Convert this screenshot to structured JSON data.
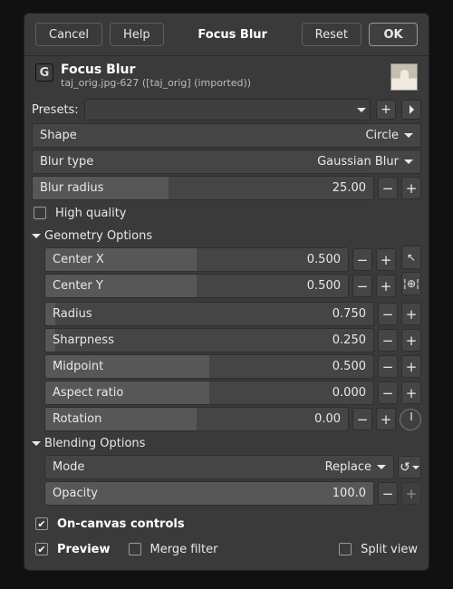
{
  "titlebar": {
    "cancel": "Cancel",
    "help": "Help",
    "name": "Focus Blur",
    "reset": "Reset",
    "ok": "OK"
  },
  "header": {
    "title": "Focus Blur",
    "subtitle": "taj_orig.jpg-627 ([taj_orig] (imported))"
  },
  "presets_label": "Presets:",
  "shape": {
    "label": "Shape",
    "value": "Circle"
  },
  "blur_type": {
    "label": "Blur type",
    "value": "Gaussian Blur"
  },
  "blur_radius": {
    "label": "Blur radius",
    "value": "25.00",
    "fill_pct": 40
  },
  "high_quality": {
    "label": "High quality",
    "checked": false
  },
  "geometry_section": "Geometry Options",
  "geom": {
    "center_x": {
      "label": "Center X",
      "value": "0.500",
      "fill_pct": 50
    },
    "center_y": {
      "label": "Center Y",
      "value": "0.500",
      "fill_pct": 50
    },
    "radius": {
      "label": "Radius",
      "value": "0.750",
      "fill_pct": 3
    },
    "sharpness": {
      "label": "Sharpness",
      "value": "0.250",
      "fill_pct": 3
    },
    "midpoint": {
      "label": "Midpoint",
      "value": "0.500",
      "fill_pct": 50
    },
    "aspect": {
      "label": "Aspect ratio",
      "value": "0.000",
      "fill_pct": 50
    },
    "rotation": {
      "label": "Rotation",
      "value": "0.00",
      "fill_pct": 50
    }
  },
  "blending_section": "Blending Options",
  "mode": {
    "label": "Mode",
    "value": "Replace"
  },
  "opacity": {
    "label": "Opacity",
    "value": "100.0",
    "fill_pct": 100
  },
  "on_canvas": {
    "label": "On-canvas controls",
    "checked": true
  },
  "preview": {
    "label": "Preview",
    "checked": true
  },
  "merge": {
    "label": "Merge filter",
    "checked": false
  },
  "split": {
    "label": "Split view",
    "checked": false
  }
}
